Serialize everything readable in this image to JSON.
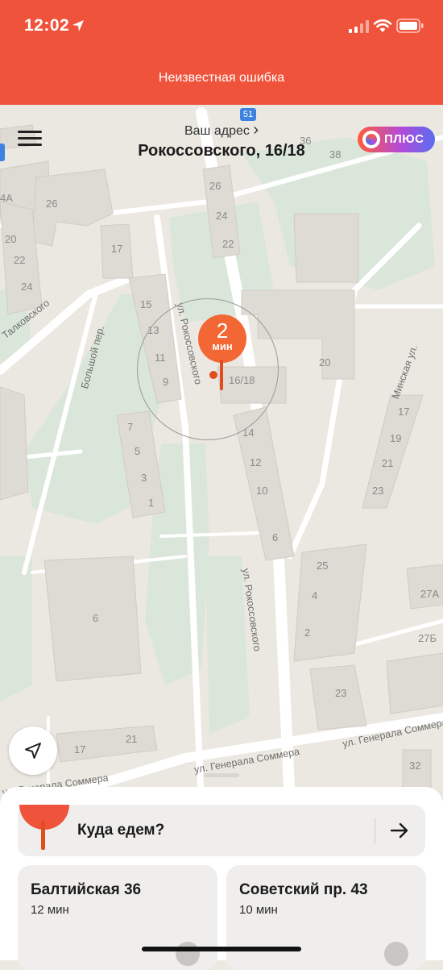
{
  "status_bar": {
    "time": "12:02"
  },
  "error_banner": {
    "text": "Неизвестная ошибка"
  },
  "header": {
    "address_caption": "Ваш адрес",
    "address_chevron": "›",
    "address": "Рокоссовского, 16/18",
    "plus_label": "ПЛЮС"
  },
  "map": {
    "pin": {
      "eta_value": "2",
      "eta_unit": "мин"
    },
    "house_numbers": [
      "4А",
      "26",
      "20",
      "22",
      "24",
      "17",
      "26",
      "24",
      "22",
      "15",
      "13",
      "11",
      "9",
      "16/18",
      "20",
      "14",
      "12",
      "10",
      "6",
      "7",
      "5",
      "3",
      "1",
      "17",
      "19",
      "21",
      "23",
      "25",
      "4",
      "2",
      "27А",
      "27Б",
      "23",
      "6",
      "21",
      "17",
      "32",
      "36",
      "38"
    ],
    "streets": [
      "Талковского",
      "Большой пер.",
      "ул. Рокоссовского",
      "ул. Рокоссовского",
      "Минская ул.",
      "ул. Генерала Соммера",
      "ул. Генерала Соммера",
      "ул. Генерала Соммера"
    ],
    "bus_stop": "51"
  },
  "sheet": {
    "where_placeholder": "Куда едем?",
    "cards": [
      {
        "title": "Балтийская 36",
        "subtitle": "12 мин"
      },
      {
        "title": "Советский пр. 43",
        "subtitle": "10 мин"
      }
    ]
  },
  "colors": {
    "accent": "#f0533c",
    "pin": "#f26734",
    "map_bg": "#ebe8e2",
    "park": "#dbe6da"
  },
  "icons": [
    "location-arrow-icon",
    "signal-icon",
    "wifi-icon",
    "battery-icon",
    "menu-icon",
    "plus-logo-icon",
    "map-pin-icon",
    "locate-me-icon",
    "arrow-right-icon",
    "pin-icon",
    "place-icon"
  ]
}
